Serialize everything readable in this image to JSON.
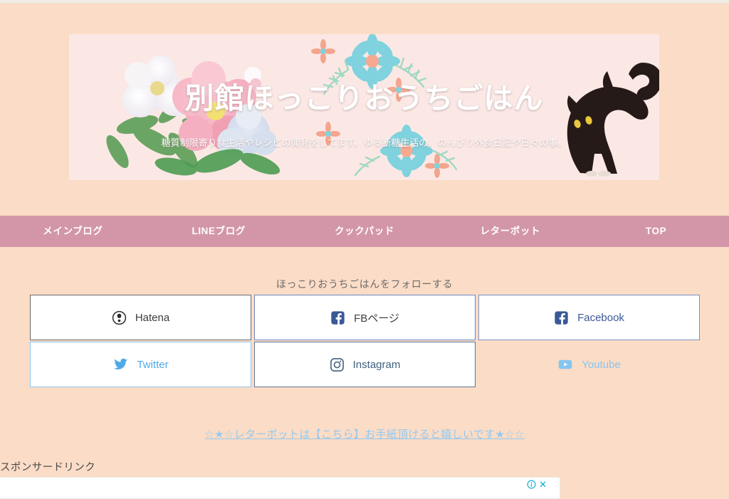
{
  "page": {
    "background_color": "#fbdcc6",
    "top_strip_color": "#f1ece4"
  },
  "banner": {
    "title": "別館ほっこりおうちごはん",
    "subtitle": "糖質制限寄り食生活やレシピの開発をしてます。ゆる断糖生活の、のんびり外食日記や日々の事。",
    "background_color": "#fbe8e5",
    "decorations": [
      "peony-flowers-icon",
      "blue-daisy-icon",
      "black-cat-icon",
      "green-leaf-sprig-icon"
    ]
  },
  "nav": {
    "background_color": "#d396a8",
    "text_color": "#ffffff",
    "items": [
      {
        "label": "メインブログ",
        "name": "nav-item-main-blog"
      },
      {
        "label": "LINEブログ",
        "name": "nav-item-line-blog"
      },
      {
        "label": "クックパッド",
        "name": "nav-item-cookpad"
      },
      {
        "label": "レターポット",
        "name": "nav-item-letterpot"
      },
      {
        "label": "TOP",
        "name": "nav-item-top"
      }
    ]
  },
  "follow": {
    "heading": "ほっこりおうちごはんをフォローする",
    "buttons": [
      {
        "label": "Hatena",
        "icon": "hatena-bookmark-icon",
        "style": "b-hatena",
        "name": "follow-button-hatena"
      },
      {
        "label": "FBページ",
        "icon": "facebook-icon",
        "style": "b-fbpage",
        "name": "follow-button-fb-page"
      },
      {
        "label": "Facebook",
        "icon": "facebook-icon",
        "style": "b-facebook",
        "name": "follow-button-facebook"
      },
      {
        "label": "Twitter",
        "icon": "twitter-bird-icon",
        "style": "b-twitter",
        "name": "follow-button-twitter"
      },
      {
        "label": "Instagram",
        "icon": "instagram-icon",
        "style": "b-instagram",
        "name": "follow-button-instagram"
      },
      {
        "label": "Youtube",
        "icon": "youtube-icon",
        "style": "b-youtube",
        "name": "follow-button-youtube"
      }
    ]
  },
  "letterpot_link": {
    "text": "☆★☆レターポットは【こちら】お手紙頂けると嬉しいです★☆☆",
    "color": "#93c9f0"
  },
  "sponsor": {
    "label": "スポンサードリンク",
    "ad_info_icon": "info-circle-icon",
    "ad_close_icon": "close-icon",
    "ad_close_glyph": "✕",
    "control_color": "#00aecd"
  }
}
